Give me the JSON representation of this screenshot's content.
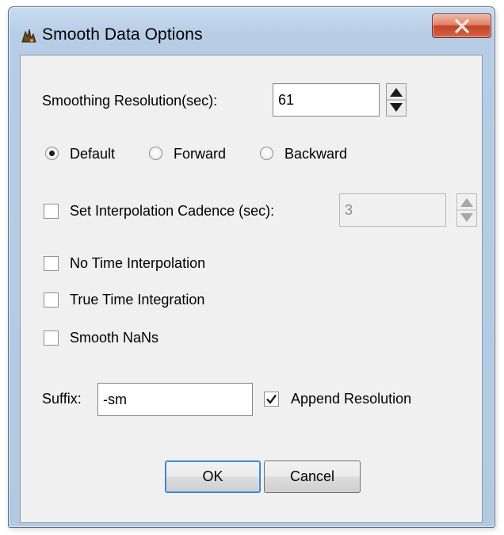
{
  "window": {
    "title": "Smooth Data Options",
    "close_label": "x"
  },
  "smoothing": {
    "label": "Smoothing Resolution(sec):",
    "value": "61"
  },
  "direction": {
    "options": [
      {
        "label": "Default",
        "selected": true
      },
      {
        "label": "Forward",
        "selected": false
      },
      {
        "label": "Backward",
        "selected": false
      }
    ]
  },
  "interpolation_cadence": {
    "label": "Set Interpolation Cadence (sec):",
    "checked": false,
    "value": "3",
    "enabled": false
  },
  "no_time_interpolation": {
    "label": "No Time Interpolation",
    "checked": false
  },
  "true_time_integration": {
    "label": "True Time Integration",
    "checked": false
  },
  "smooth_nans": {
    "label": "Smooth NaNs",
    "checked": false
  },
  "suffix": {
    "label": "Suffix:",
    "value": "-sm"
  },
  "append_resolution": {
    "label": "Append Resolution",
    "checked": true
  },
  "buttons": {
    "ok": "OK",
    "cancel": "Cancel"
  }
}
